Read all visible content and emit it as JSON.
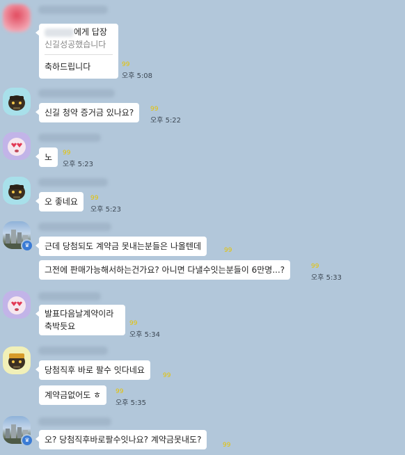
{
  "messages": {
    "m1": {
      "reply_to": "에게 답장",
      "quote": "신길성공했습니다",
      "text": "축하드립니다",
      "unread": "99",
      "time": "오후 5:08"
    },
    "m2": {
      "text": "신길 청약 증거금 있나요?",
      "unread": "99",
      "time": "오후 5:22"
    },
    "m3": {
      "text": "노",
      "unread": "99",
      "time": "오후 5:23"
    },
    "m4": {
      "text": "오 좋네요",
      "unread": "99",
      "time": "오후 5:23"
    },
    "m5": {
      "text": "근데 당첨되도 계약금 못내는분들은 나올텐데",
      "unread": "99"
    },
    "m6": {
      "text": "그전에 판매가능해서하는건가요? 아니면 다낼수잇는분들이 6만명...?",
      "unread": "99",
      "time": "오후 5:33"
    },
    "m7": {
      "text": "발표다음날계약이라 축박듯요",
      "unread": "99",
      "time": "오후 5:34"
    },
    "m8": {
      "text": "당첨직후 바로 팔수 잇다네요",
      "unread": "99"
    },
    "m9": {
      "text": "계약금없어도 ㅎ",
      "unread": "99",
      "time": "오후 5:35"
    },
    "m10": {
      "text": "오? 당첨직후바로팔수잇나요? 계약금못내도?",
      "unread": "99"
    }
  },
  "colors": {
    "background": "#b2c7da",
    "bubble": "#ffffff",
    "unread": "#e6c300"
  }
}
